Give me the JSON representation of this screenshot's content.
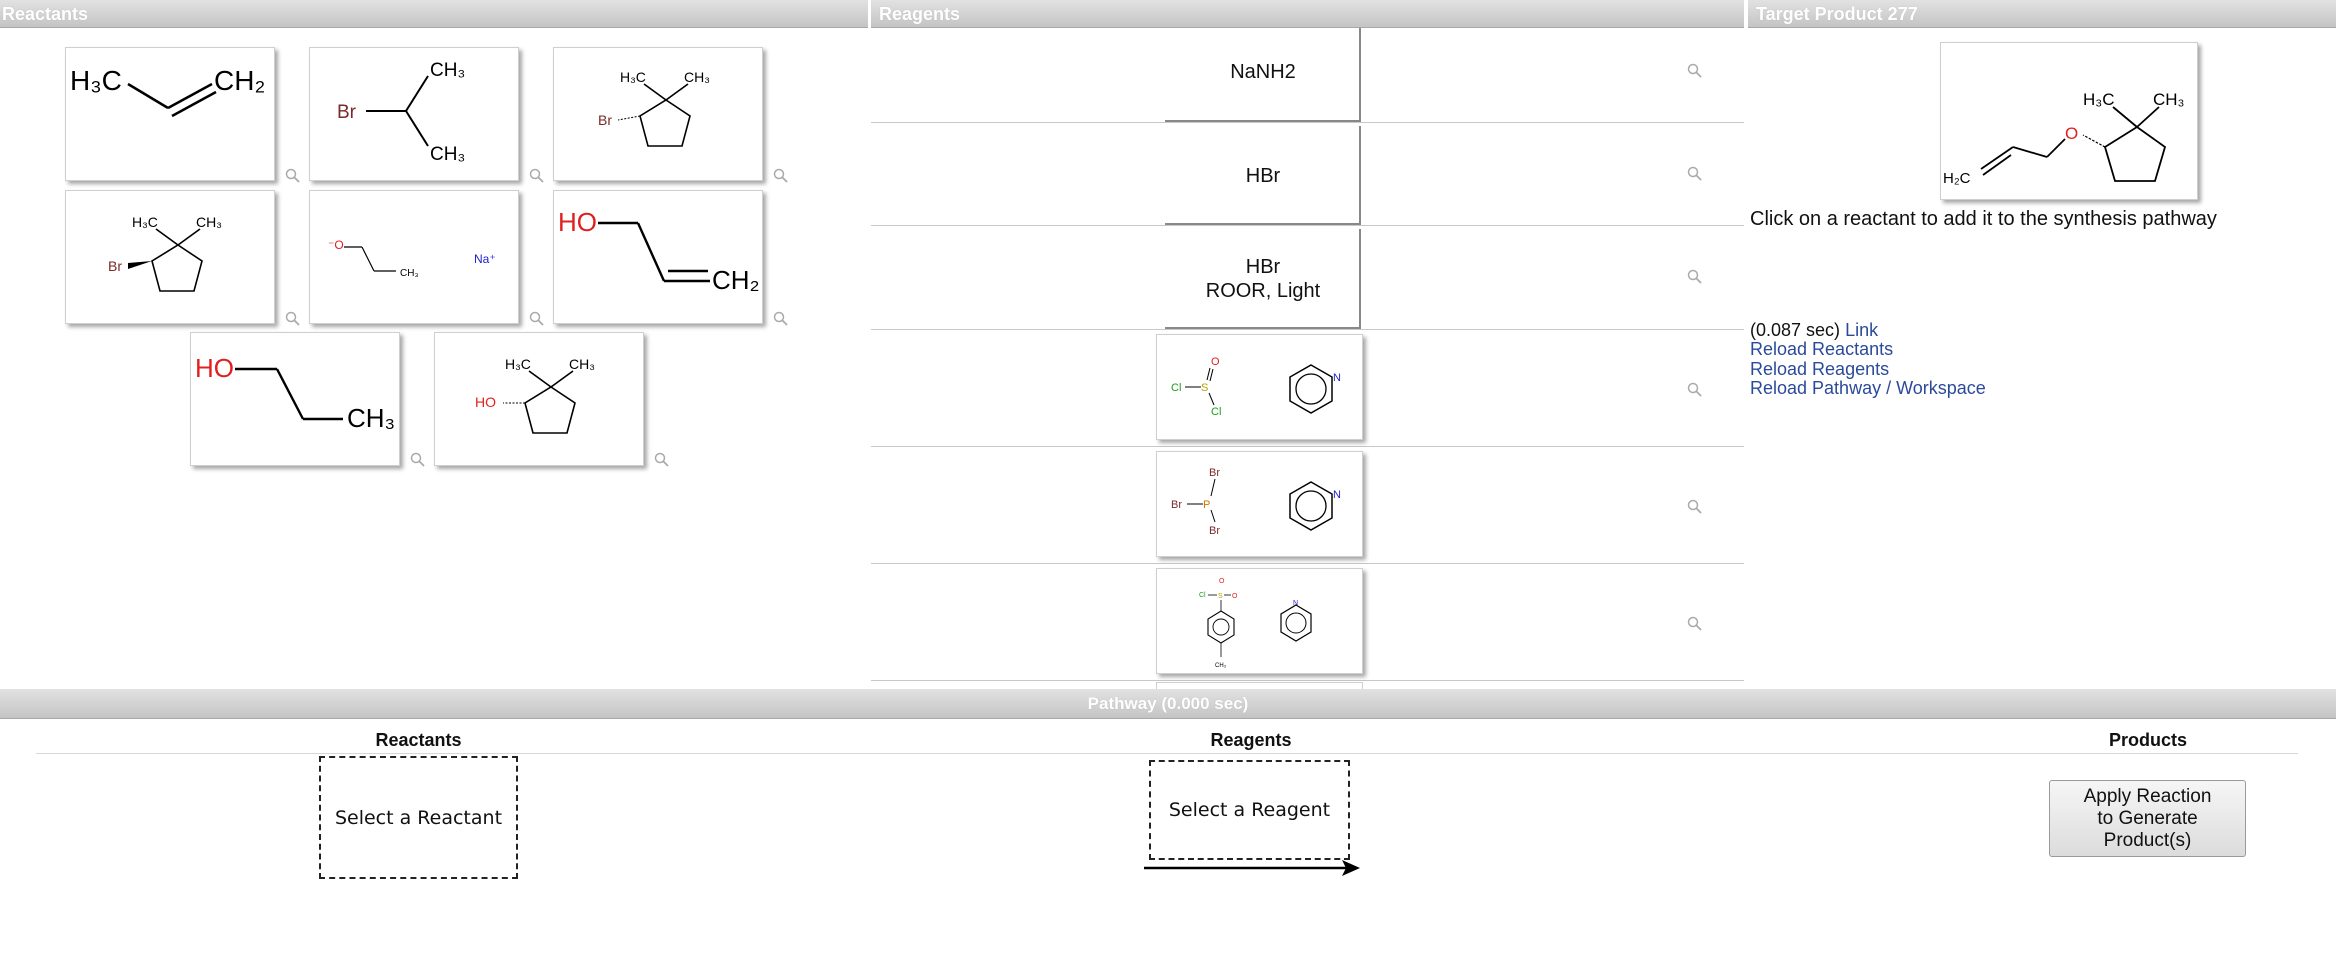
{
  "panels": {
    "reactants_title": "Reactants",
    "reagents_title": "Reagents",
    "target_title": "Target Product 277"
  },
  "target": {
    "instruction": "Click on a reactant to add it to the synthesis pathway",
    "timing": "(0.087 sec)",
    "link_label": "Link",
    "reload_reactants": "Reload Reactants",
    "reload_reagents": "Reload Reagents",
    "reload_pathway": "Reload Pathway / Workspace"
  },
  "reagents": [
    {
      "line1": "NaNH2",
      "line2": ""
    },
    {
      "line1": "HBr",
      "line2": ""
    },
    {
      "line1": "HBr",
      "line2": "ROOR, Light"
    }
  ],
  "pathway": {
    "title": "Pathway (0.000 sec)",
    "col_reactants": "Reactants",
    "col_reagents": "Reagents",
    "col_products": "Products",
    "select_reactant": "Select a Reactant",
    "select_reagent": "Select a Reagent",
    "apply_line1": "Apply Reaction",
    "apply_line2": "to Generate",
    "apply_line3": "Product(s)"
  },
  "chem_labels": {
    "h3c": "H₃C",
    "ch2": "CH₂",
    "ch3": "CH₃",
    "br": "Br",
    "ho": "HO",
    "o_minus": "⁻O",
    "na_plus": "Na⁺",
    "cl": "Cl",
    "s": "S",
    "o": "O",
    "p": "P",
    "n": "N",
    "h2c": "H₂C"
  },
  "colors": {
    "header_top": "#e2e2e2",
    "header_bottom": "#c4c4c4",
    "link": "#2b4a9a",
    "oxygen": "#e02020",
    "bromine": "#7a2a2a",
    "chlorine": "#1aa01a",
    "nitrogen": "#2020d0",
    "sodium": "#2020d0"
  }
}
